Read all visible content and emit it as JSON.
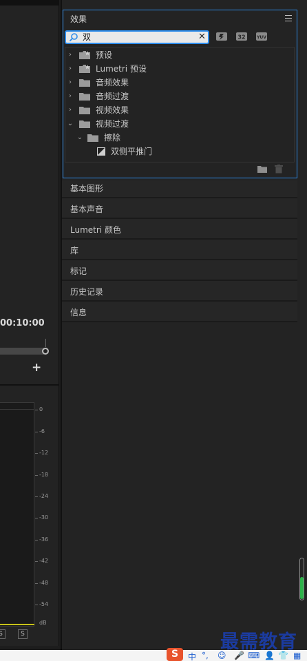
{
  "program_monitor": {
    "timecode": "00:10:00",
    "add_button": "+"
  },
  "audio_meter": {
    "db_labels": [
      "0",
      "-6",
      "-12",
      "-18",
      "-24",
      "-30",
      "-36",
      "-42",
      "-48",
      "-54",
      "dB"
    ],
    "solo_left": "S",
    "solo_right": "S"
  },
  "effects_panel": {
    "title": "效果",
    "search": {
      "value": "双",
      "placeholder": ""
    },
    "tree": [
      {
        "label": "预设",
        "expanded": false,
        "icon": "preset-folder-icon"
      },
      {
        "label": "Lumetri 预设",
        "expanded": false,
        "icon": "preset-folder-icon"
      },
      {
        "label": "音频效果",
        "expanded": false,
        "icon": "folder-icon"
      },
      {
        "label": "音频过渡",
        "expanded": false,
        "icon": "folder-icon"
      },
      {
        "label": "视频效果",
        "expanded": false,
        "icon": "folder-icon"
      },
      {
        "label": "视频过渡",
        "expanded": true,
        "icon": "folder-icon"
      },
      {
        "label": "擦除",
        "expanded": true,
        "icon": "folder-icon"
      },
      {
        "label": "双侧平推门",
        "icon": "transition-icon"
      }
    ]
  },
  "collapsed_panels": [
    {
      "label": "基本图形"
    },
    {
      "label": "基本声音"
    },
    {
      "label": "Lumetri 颜色"
    },
    {
      "label": "库"
    },
    {
      "label": "标记"
    },
    {
      "label": "历史记录"
    },
    {
      "label": "信息"
    }
  ],
  "watermark": "最需教育",
  "ime_tray": {
    "logo": "S",
    "lang": "中",
    "punct": "°,"
  },
  "colors": {
    "accent": "#2d8ceb",
    "panel_bg": "#232323",
    "meter_green": "#2db34a",
    "meter_yellow": "#c7c219"
  }
}
